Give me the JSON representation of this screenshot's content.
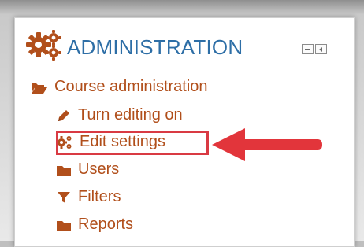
{
  "block": {
    "title": "ADMINISTRATION",
    "icon": "gears-icon",
    "controls": [
      "minimize-icon",
      "dock-icon"
    ]
  },
  "tree": {
    "course_admin": {
      "label": "Course administration",
      "icon": "folder-open-icon"
    },
    "turn_editing": {
      "label": "Turn editing on",
      "icon": "pencil-icon"
    },
    "edit_settings": {
      "label": "Edit settings",
      "icon": "gears-icon"
    },
    "users": {
      "label": "Users",
      "icon": "folder-icon"
    },
    "filters": {
      "label": "Filters",
      "icon": "filter-icon"
    },
    "reports": {
      "label": "Reports",
      "icon": "folder-icon"
    }
  },
  "annotation": {
    "highlight_color": "#d93a43",
    "arrow_color": "#e2353b"
  },
  "colors": {
    "title": "#2d6ea6",
    "link": "#b14f1b",
    "icon": "#b14f1b"
  }
}
